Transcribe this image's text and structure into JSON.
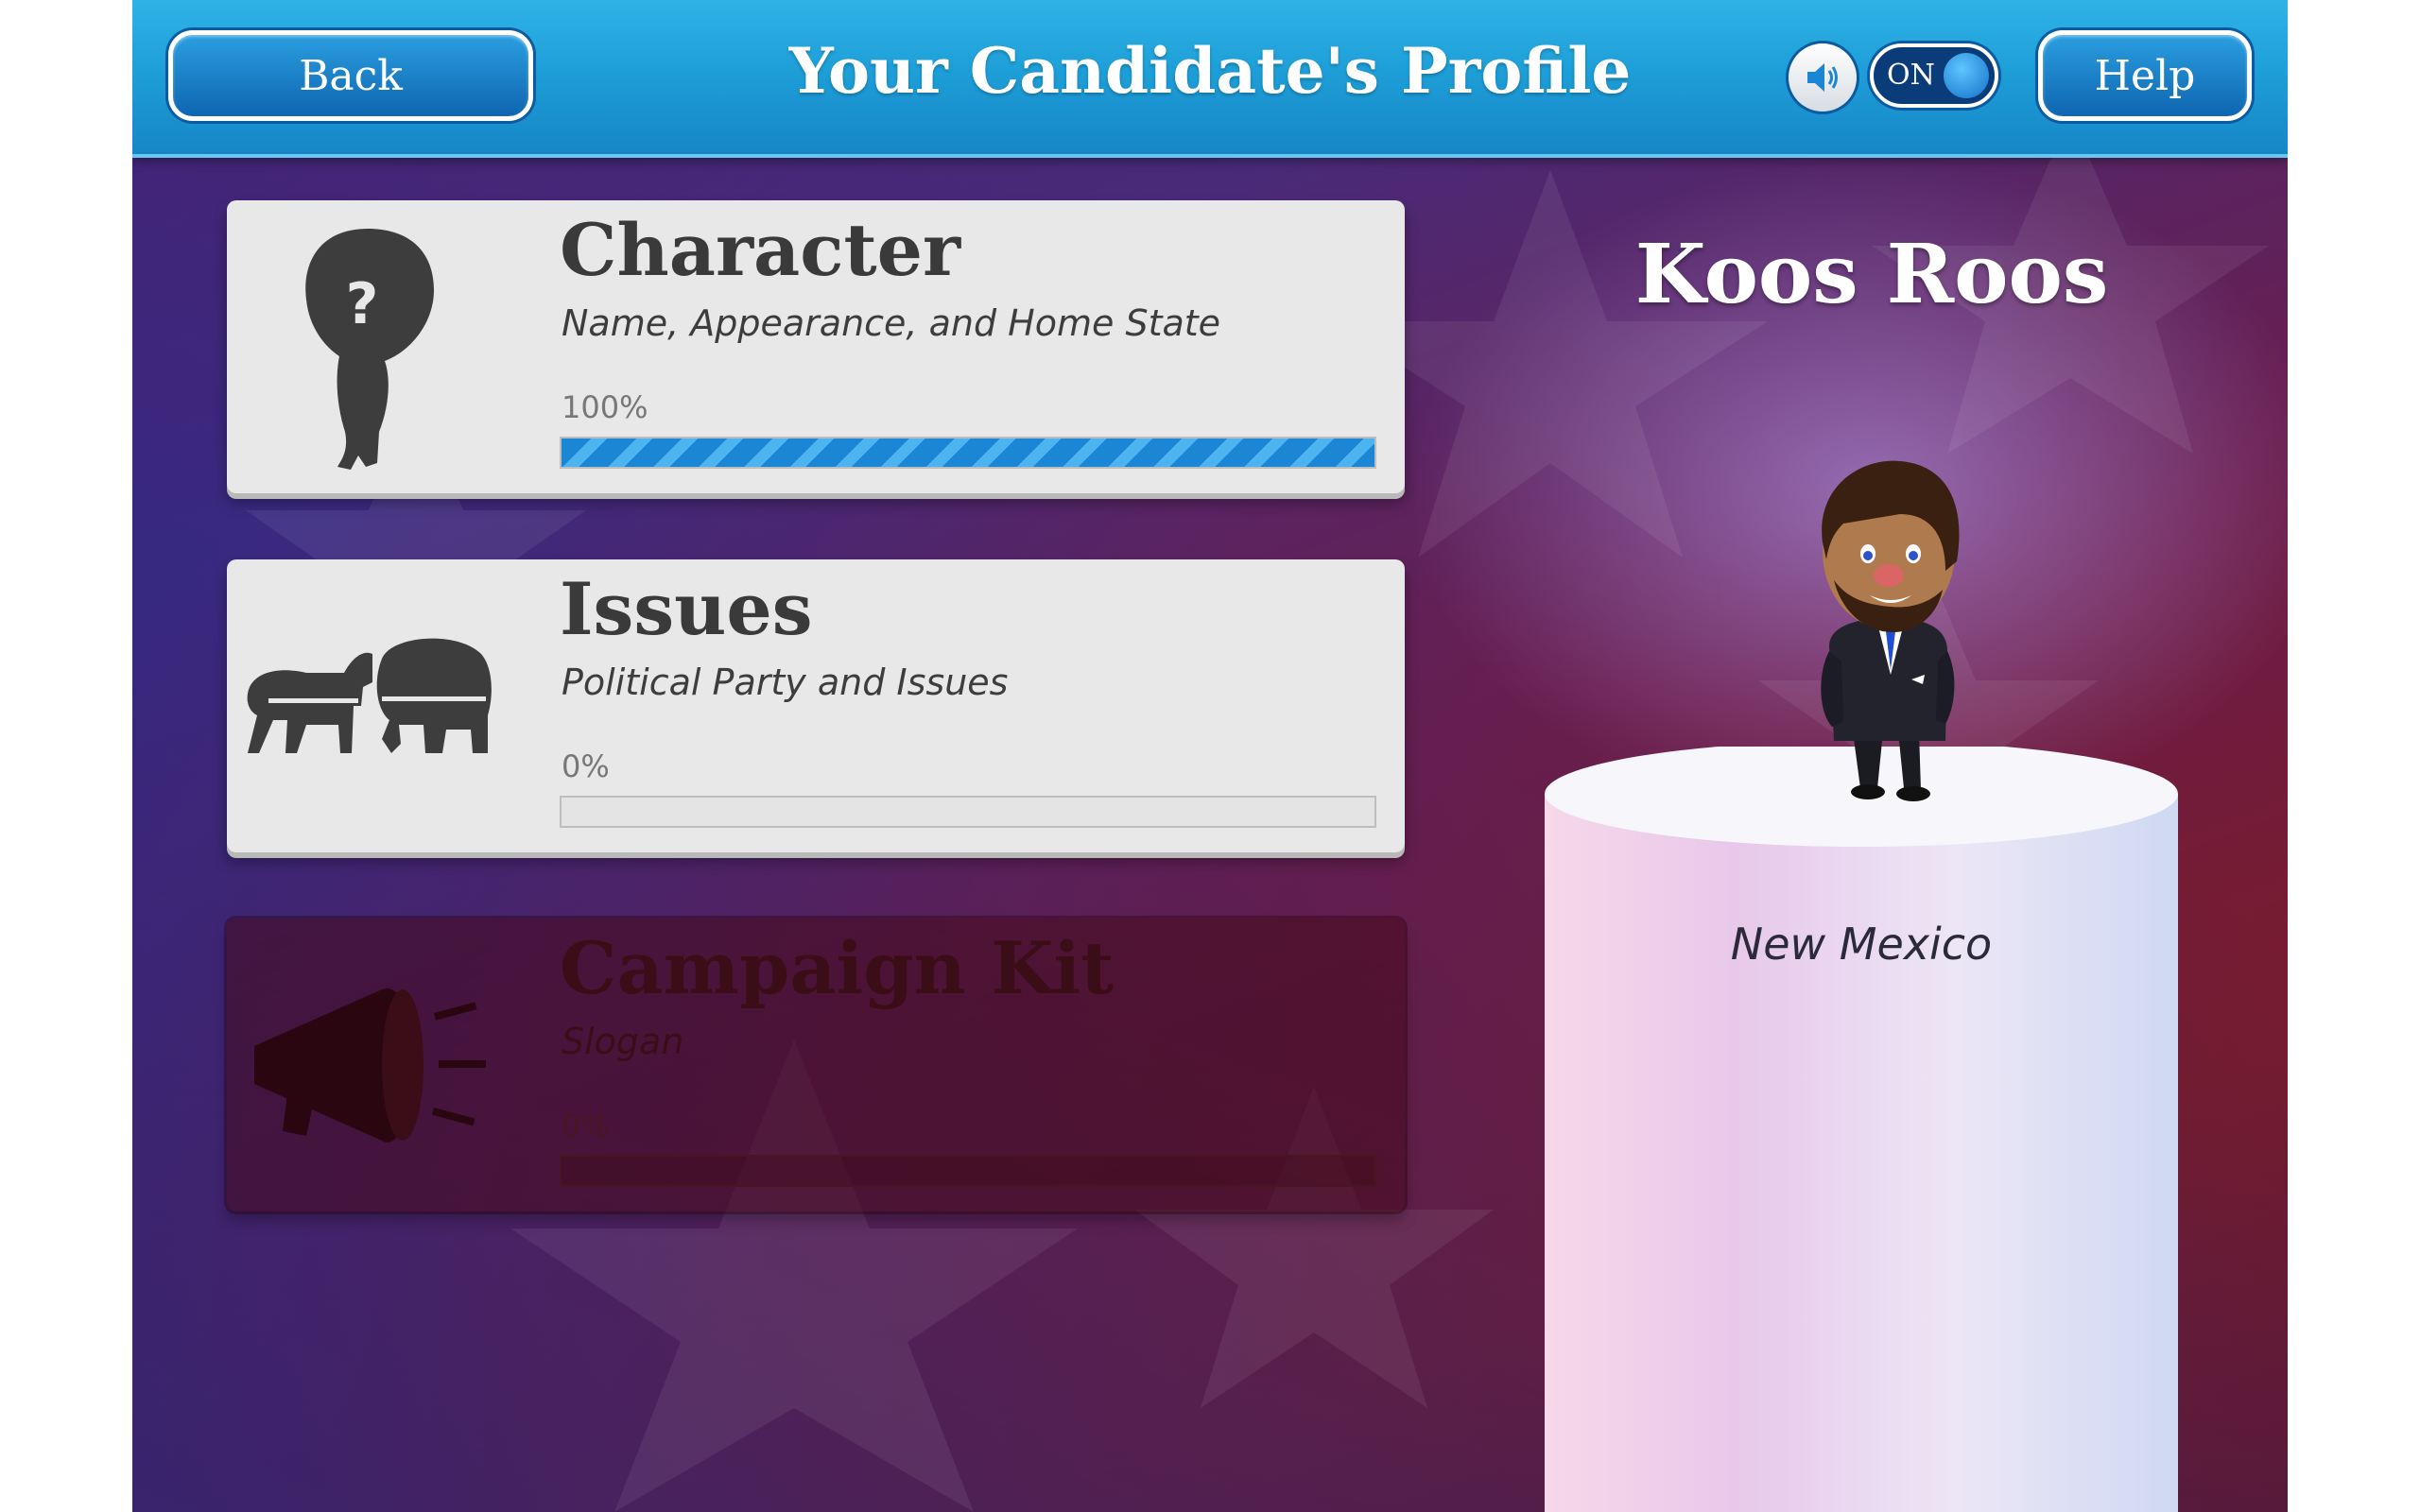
{
  "header": {
    "back_label": "Back",
    "title": "Your Candidate's Profile",
    "sound_toggle_label": "ON",
    "help_label": "Help"
  },
  "cards": [
    {
      "title": "Character",
      "subtitle": "Name, Appearance, and Home State",
      "progress_text": "100%",
      "progress": 1.0,
      "icon": "head-silhouette-icon",
      "enabled": true
    },
    {
      "title": "Issues",
      "subtitle": "Political Party and Issues",
      "progress_text": "0%",
      "progress": 0,
      "icon": "donkey-elephant-icon",
      "enabled": true
    },
    {
      "title": "Campaign Kit",
      "subtitle": "Slogan",
      "progress_text": "0%",
      "progress": 0,
      "icon": "megaphone-icon",
      "enabled": false
    }
  ],
  "candidate": {
    "name": "Koos Roos",
    "home_state": "New Mexico"
  },
  "colors": {
    "header_blue": "#1e9fd8",
    "button_blue": "#0f66b0",
    "progress_blue": "#1b86d4",
    "card_bg": "#e8e8e8"
  }
}
